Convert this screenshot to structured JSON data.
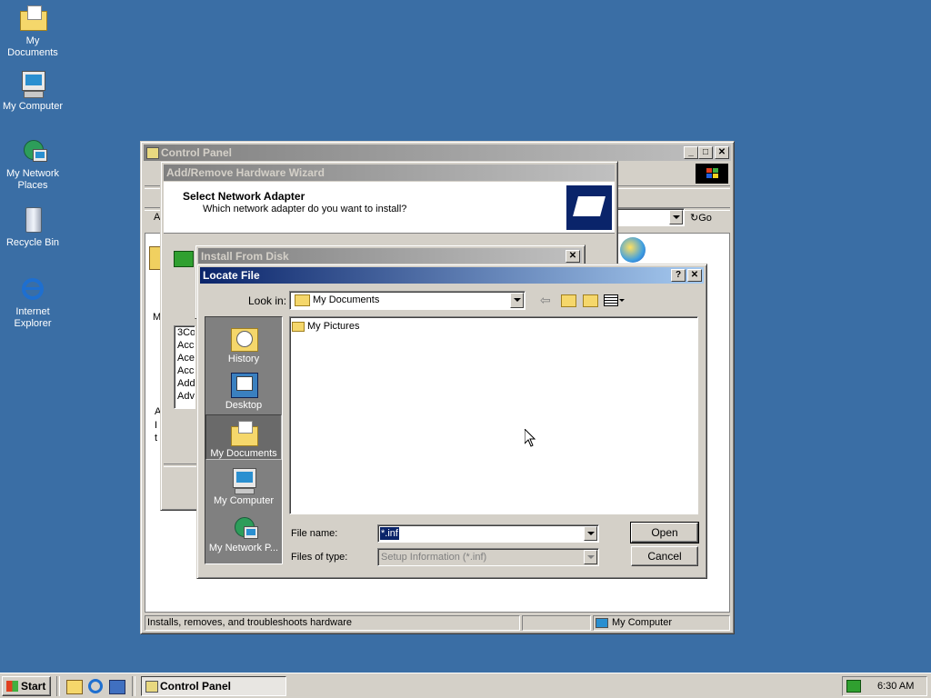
{
  "desktop": {
    "icons": [
      {
        "label": "My Documents",
        "icon": "folder-icon"
      },
      {
        "label": "My Computer",
        "icon": "computer-icon"
      },
      {
        "label_line1": "My Network",
        "label_line2": "Places",
        "icon": "network-icon"
      },
      {
        "label": "Recycle Bin",
        "icon": "recycle-bin-icon"
      },
      {
        "label_line1": "Internet",
        "label_line2": "Explorer",
        "icon": "internet-explorer-icon"
      }
    ]
  },
  "control_panel": {
    "title": "Control Panel",
    "go_label": "Go",
    "address_prefix": "A",
    "left_text": {
      "manuf": "Manu",
      "a": "A",
      "i": "I",
      "t": "t"
    },
    "list_items": [
      "3Co",
      "Acc",
      "Ace",
      "Acc",
      "Add",
      "Adv"
    ],
    "status_text": "Installs, removes, and troubleshoots hardware",
    "status_zone": "My Computer"
  },
  "wizard": {
    "title": "Add/Remove Hardware Wizard",
    "heading": "Select Network Adapter",
    "subheading": "Which network adapter do you want to install?"
  },
  "install_from_disk": {
    "title": "Install From Disk"
  },
  "locate_file": {
    "title": "Locate File",
    "help_label": "?",
    "close_label": "✕",
    "look_in_label": "Look in:",
    "look_in_value": "My Documents",
    "places": [
      {
        "label": "History",
        "icon": "history-icon"
      },
      {
        "label": "Desktop",
        "icon": "desktop-icon"
      },
      {
        "label": "My Documents",
        "icon": "my-documents-icon"
      },
      {
        "label": "My Computer",
        "icon": "my-computer-icon"
      },
      {
        "label": "My Network P...",
        "icon": "my-network-places-icon"
      }
    ],
    "files": [
      {
        "name": "My Pictures",
        "icon": "pictures-folder-icon"
      }
    ],
    "file_name_label": "File name:",
    "file_name_value": "*.inf",
    "files_of_type_label": "Files of type:",
    "files_of_type_value": "Setup Information (*.inf)",
    "open_label": "Open",
    "cancel_label": "Cancel"
  },
  "taskbar": {
    "start_label": "Start",
    "task_label": "Control Panel",
    "clock": "6:30 AM"
  }
}
